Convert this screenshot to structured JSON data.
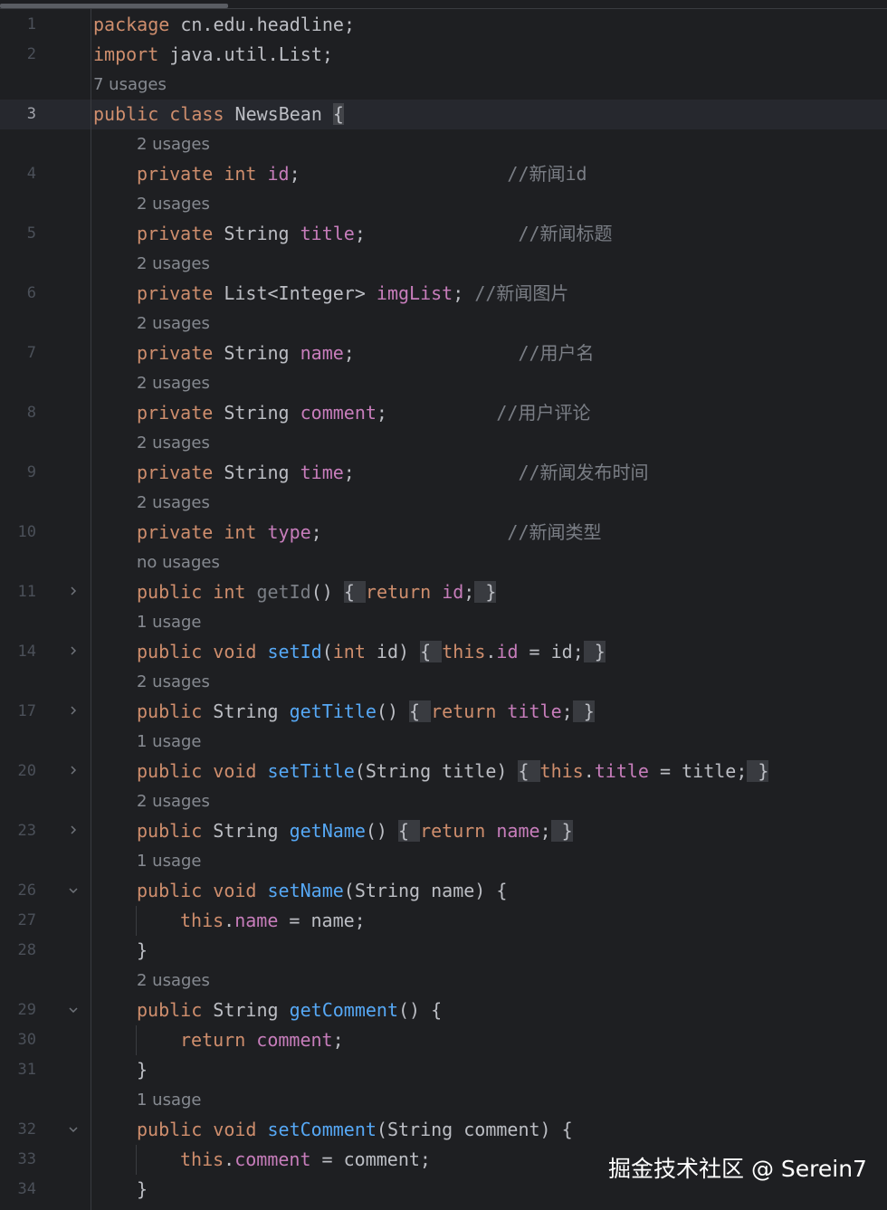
{
  "editor": {
    "lines": [
      {
        "kind": "code",
        "num": "1",
        "fold": "",
        "indent": 0,
        "tokens": [
          [
            "kw",
            "package"
          ],
          [
            "pln",
            " cn.edu.headline;"
          ]
        ]
      },
      {
        "kind": "code",
        "num": "2",
        "fold": "",
        "indent": 0,
        "tokens": [
          [
            "kw",
            "import"
          ],
          [
            "pln",
            " java.util.List;"
          ]
        ]
      },
      {
        "kind": "hint",
        "indent": 0,
        "text": "7 usages"
      },
      {
        "kind": "code",
        "num": "3",
        "fold": "",
        "indent": 0,
        "current": true,
        "tokens": [
          [
            "kw",
            "public class"
          ],
          [
            "pln",
            " NewsBean "
          ],
          [
            "caret",
            "{"
          ]
        ]
      },
      {
        "kind": "hint",
        "indent": 1,
        "text": "2 usages"
      },
      {
        "kind": "code",
        "num": "4",
        "fold": "",
        "indent": 1,
        "tokens": [
          [
            "kw",
            "private int"
          ],
          [
            "pln",
            " "
          ],
          [
            "fld",
            "id"
          ],
          [
            "pln",
            ";                   "
          ],
          [
            "cmt",
            "//新闻id"
          ]
        ]
      },
      {
        "kind": "hint",
        "indent": 1,
        "text": "2 usages"
      },
      {
        "kind": "code",
        "num": "5",
        "fold": "",
        "indent": 1,
        "tokens": [
          [
            "kw",
            "private"
          ],
          [
            "pln",
            " String "
          ],
          [
            "fld",
            "title"
          ],
          [
            "pln",
            ";              "
          ],
          [
            "cmt",
            "//新闻标题"
          ]
        ]
      },
      {
        "kind": "hint",
        "indent": 1,
        "text": "2 usages"
      },
      {
        "kind": "code",
        "num": "6",
        "fold": "",
        "indent": 1,
        "tokens": [
          [
            "kw",
            "private"
          ],
          [
            "pln",
            " List<Integer> "
          ],
          [
            "fld",
            "imgList"
          ],
          [
            "pln",
            "; "
          ],
          [
            "cmt",
            "//新闻图片"
          ]
        ]
      },
      {
        "kind": "hint",
        "indent": 1,
        "text": "2 usages"
      },
      {
        "kind": "code",
        "num": "7",
        "fold": "",
        "indent": 1,
        "tokens": [
          [
            "kw",
            "private"
          ],
          [
            "pln",
            " String "
          ],
          [
            "fld",
            "name"
          ],
          [
            "pln",
            ";               "
          ],
          [
            "cmt",
            "//用户名"
          ]
        ]
      },
      {
        "kind": "hint",
        "indent": 1,
        "text": "2 usages"
      },
      {
        "kind": "code",
        "num": "8",
        "fold": "",
        "indent": 1,
        "tokens": [
          [
            "kw",
            "private"
          ],
          [
            "pln",
            " String "
          ],
          [
            "fld",
            "comment"
          ],
          [
            "pln",
            ";          "
          ],
          [
            "cmt",
            "//用户评论"
          ]
        ]
      },
      {
        "kind": "hint",
        "indent": 1,
        "text": "2 usages"
      },
      {
        "kind": "code",
        "num": "9",
        "fold": "",
        "indent": 1,
        "tokens": [
          [
            "kw",
            "private"
          ],
          [
            "pln",
            " String "
          ],
          [
            "fld",
            "time"
          ],
          [
            "pln",
            ";               "
          ],
          [
            "cmt",
            "//新闻发布时间"
          ]
        ]
      },
      {
        "kind": "hint",
        "indent": 1,
        "text": "2 usages"
      },
      {
        "kind": "code",
        "num": "10",
        "fold": "",
        "indent": 1,
        "tokens": [
          [
            "kw",
            "private int"
          ],
          [
            "pln",
            " "
          ],
          [
            "fld",
            "type"
          ],
          [
            "pln",
            ";                 "
          ],
          [
            "cmt",
            "//新闻类型"
          ]
        ]
      },
      {
        "kind": "hint",
        "indent": 1,
        "text": "no usages"
      },
      {
        "kind": "code",
        "num": "11",
        "fold": "right",
        "indent": 1,
        "tokens": [
          [
            "kw",
            "public int"
          ],
          [
            "pln",
            " "
          ],
          [
            "gry",
            "getId"
          ],
          [
            "pln",
            "() "
          ],
          [
            "fb",
            "{ "
          ],
          [
            "kw",
            "return"
          ],
          [
            "pln",
            " "
          ],
          [
            "fld",
            "id"
          ],
          [
            "pln",
            ";"
          ],
          [
            "fb",
            " }"
          ]
        ]
      },
      {
        "kind": "hint",
        "indent": 1,
        "text": "1 usage"
      },
      {
        "kind": "code",
        "num": "14",
        "fold": "right",
        "indent": 1,
        "tokens": [
          [
            "kw",
            "public void"
          ],
          [
            "pln",
            " "
          ],
          [
            "fn",
            "setId"
          ],
          [
            "pln",
            "("
          ],
          [
            "kw",
            "int"
          ],
          [
            "pln",
            " id) "
          ],
          [
            "fb",
            "{ "
          ],
          [
            "kw",
            "this"
          ],
          [
            "pln",
            "."
          ],
          [
            "fld",
            "id"
          ],
          [
            "pln",
            " = id;"
          ],
          [
            "fb",
            " }"
          ]
        ]
      },
      {
        "kind": "hint",
        "indent": 1,
        "text": "2 usages"
      },
      {
        "kind": "code",
        "num": "17",
        "fold": "right",
        "indent": 1,
        "tokens": [
          [
            "kw",
            "public"
          ],
          [
            "pln",
            " String "
          ],
          [
            "fn",
            "getTitle"
          ],
          [
            "pln",
            "() "
          ],
          [
            "fb",
            "{ "
          ],
          [
            "kw",
            "return"
          ],
          [
            "pln",
            " "
          ],
          [
            "fld",
            "title"
          ],
          [
            "pln",
            ";"
          ],
          [
            "fb",
            " }"
          ]
        ]
      },
      {
        "kind": "hint",
        "indent": 1,
        "text": "1 usage"
      },
      {
        "kind": "code",
        "num": "20",
        "fold": "right",
        "indent": 1,
        "tokens": [
          [
            "kw",
            "public void"
          ],
          [
            "pln",
            " "
          ],
          [
            "fn",
            "setTitle"
          ],
          [
            "pln",
            "(String title) "
          ],
          [
            "fb",
            "{ "
          ],
          [
            "kw",
            "this"
          ],
          [
            "pln",
            "."
          ],
          [
            "fld",
            "title"
          ],
          [
            "pln",
            " = title;"
          ],
          [
            "fb",
            " }"
          ]
        ]
      },
      {
        "kind": "hint",
        "indent": 1,
        "text": "2 usages"
      },
      {
        "kind": "code",
        "num": "23",
        "fold": "right",
        "indent": 1,
        "tokens": [
          [
            "kw",
            "public"
          ],
          [
            "pln",
            " String "
          ],
          [
            "fn",
            "getName"
          ],
          [
            "pln",
            "() "
          ],
          [
            "fb",
            "{ "
          ],
          [
            "kw",
            "return"
          ],
          [
            "pln",
            " "
          ],
          [
            "fld",
            "name"
          ],
          [
            "pln",
            ";"
          ],
          [
            "fb",
            " }"
          ]
        ]
      },
      {
        "kind": "hint",
        "indent": 1,
        "text": "1 usage"
      },
      {
        "kind": "code",
        "num": "26",
        "fold": "down",
        "indent": 1,
        "tokens": [
          [
            "kw",
            "public void"
          ],
          [
            "pln",
            " "
          ],
          [
            "fn",
            "setName"
          ],
          [
            "pln",
            "(String name) {"
          ]
        ]
      },
      {
        "kind": "code",
        "num": "27",
        "fold": "",
        "indent": 2,
        "guide": true,
        "tokens": [
          [
            "kw",
            "this"
          ],
          [
            "pln",
            "."
          ],
          [
            "fld",
            "name"
          ],
          [
            "pln",
            " = name;"
          ]
        ]
      },
      {
        "kind": "code",
        "num": "28",
        "fold": "",
        "indent": 1,
        "tokens": [
          [
            "pln",
            "}"
          ]
        ]
      },
      {
        "kind": "hint",
        "indent": 1,
        "text": "2 usages"
      },
      {
        "kind": "code",
        "num": "29",
        "fold": "down",
        "indent": 1,
        "tokens": [
          [
            "kw",
            "public"
          ],
          [
            "pln",
            " String "
          ],
          [
            "fn",
            "getComment"
          ],
          [
            "pln",
            "() {"
          ]
        ]
      },
      {
        "kind": "code",
        "num": "30",
        "fold": "",
        "indent": 2,
        "guide": true,
        "tokens": [
          [
            "kw",
            "return"
          ],
          [
            "pln",
            " "
          ],
          [
            "fld",
            "comment"
          ],
          [
            "pln",
            ";"
          ]
        ]
      },
      {
        "kind": "code",
        "num": "31",
        "fold": "",
        "indent": 1,
        "tokens": [
          [
            "pln",
            "}"
          ]
        ]
      },
      {
        "kind": "hint",
        "indent": 1,
        "text": "1 usage"
      },
      {
        "kind": "code",
        "num": "32",
        "fold": "down",
        "indent": 1,
        "tokens": [
          [
            "kw",
            "public void"
          ],
          [
            "pln",
            " "
          ],
          [
            "fn",
            "setComment"
          ],
          [
            "pln",
            "(String comment) {"
          ]
        ]
      },
      {
        "kind": "code",
        "num": "33",
        "fold": "",
        "indent": 2,
        "guide": true,
        "tokens": [
          [
            "kw",
            "this"
          ],
          [
            "pln",
            "."
          ],
          [
            "fld",
            "comment"
          ],
          [
            "pln",
            " = comment;"
          ]
        ]
      },
      {
        "kind": "code",
        "num": "34",
        "fold": "",
        "indent": 1,
        "tokens": [
          [
            "pln",
            "}"
          ]
        ]
      }
    ]
  },
  "icons": {
    "fold_collapsed": "chevron-right-icon",
    "fold_expanded": "chevron-down-icon"
  },
  "colors": {
    "background": "#1e1f22",
    "keyword": "#cf8e6d",
    "field": "#c77dbb",
    "method": "#56a8f5",
    "comment": "#7a7e85",
    "text": "#bcbec4",
    "inlay_hint": "#868a91"
  },
  "watermark": "掘金技术社区 @ Serein7"
}
